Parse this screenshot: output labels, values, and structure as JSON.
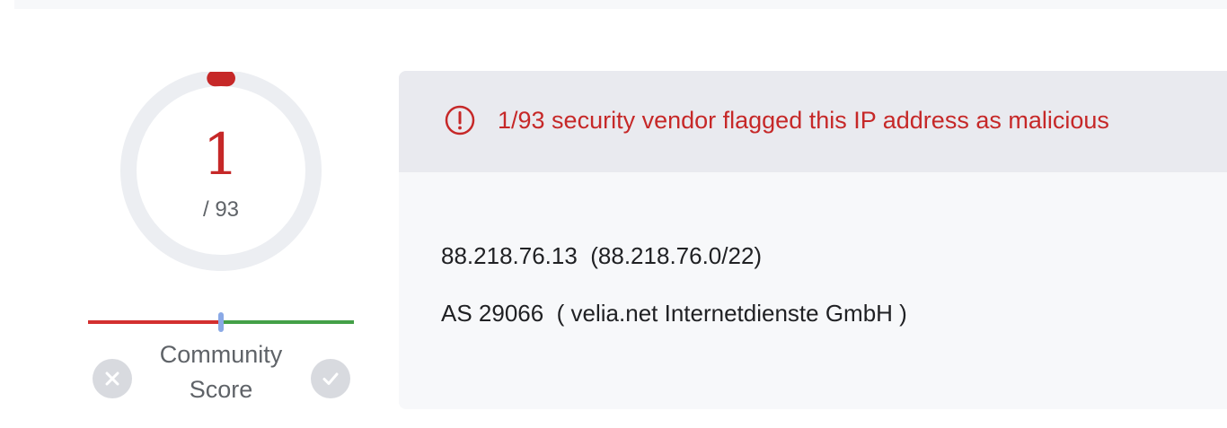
{
  "detection": {
    "malicious_count": "1",
    "total_label": "/ 93",
    "ratio": 0.0108,
    "color": "#c62828",
    "ring_color": "#eceef2"
  },
  "community": {
    "label_line1": "Community",
    "label_line2": "Score",
    "marker_position": 0.5,
    "negative_color": "#d32f2f",
    "positive_color": "#43a047",
    "marker_color": "#8aa9e6",
    "down_icon": "close-circle-icon",
    "up_icon": "check-circle-icon"
  },
  "alert": {
    "icon": "alert-circle-icon",
    "text": "1/93 security vendor flagged this IP address as malicious"
  },
  "network": {
    "ip_line": "88.218.76.13  (88.218.76.0/22)",
    "as_line": "AS 29066  ( velia.net Internetdienste GmbH )"
  }
}
